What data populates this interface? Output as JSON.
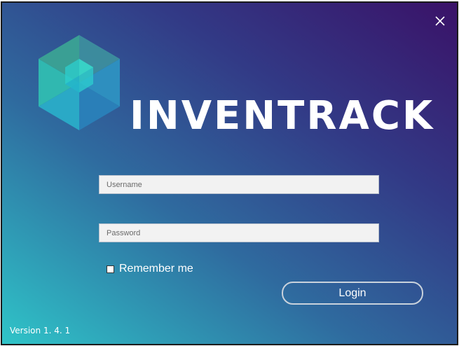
{
  "app": {
    "title": "INVENTRACK",
    "version_label": "Version 1. 4. 1"
  },
  "login_form": {
    "username": {
      "value": "",
      "placeholder": "Username"
    },
    "password": {
      "value": "",
      "placeholder": "Password"
    },
    "remember_me": {
      "label": "Remember me",
      "checked": false
    },
    "login_label": "Login"
  },
  "icons": {
    "close": "close-icon",
    "logo": "hexagon-logo"
  },
  "colors": {
    "gradient_top_right": "#3a1268",
    "gradient_mid": "#2f6b9f",
    "gradient_bottom_left": "#2fc4c8",
    "field_background": "#f2f2f2",
    "text": "#ffffff"
  }
}
